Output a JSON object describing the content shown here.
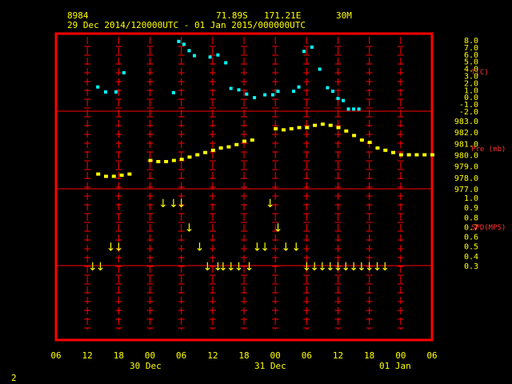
{
  "header": {
    "station_id": "8984",
    "latitude": "71.89S",
    "longitude": "171.21E",
    "interval": "30M",
    "time_range": "29 Dec 2014/120000UTC - 01 Jan 2015/000000UTC"
  },
  "footer": {
    "page_number": "2"
  },
  "colors": {
    "frame": "#ff0000",
    "text": "#ffff00",
    "temperature": "#00ffff",
    "pressure": "#ffff00",
    "wind": "#ffff00"
  },
  "chart_data": [
    {
      "type": "scatter",
      "panel": "temperature",
      "ylabel": "T(C)",
      "ylim": [
        -2.0,
        8.0
      ],
      "yticks": [
        "8.0",
        "7.0",
        "6.0",
        "5.0",
        "4.0",
        "3.0",
        "2.0",
        "1.0",
        "0.0",
        "-1.0",
        "-2.0"
      ],
      "x_hours": [
        14,
        15.5,
        17.5,
        19,
        28.5,
        29.5,
        30.5,
        31.5,
        32.5,
        35.5,
        37,
        38.5,
        39.5,
        41,
        42.5,
        44,
        46,
        47.5,
        48.5,
        51.5,
        52.5,
        53.5,
        55,
        56.5,
        58,
        59,
        60,
        61,
        62,
        63,
        64
      ],
      "values": [
        1.4,
        0.7,
        0.7,
        3.4,
        0.6,
        7.8,
        7.4,
        6.5,
        5.8,
        5.6,
        5.9,
        4.8,
        1.2,
        1.0,
        0.4,
        -0.1,
        0.3,
        0.3,
        0.8,
        0.8,
        1.4,
        6.4,
        7.0,
        3.9,
        1.3,
        0.8,
        -0.2,
        -0.5,
        -1.7,
        -1.7,
        -1.7,
        -0.8,
        -0.2,
        0.0
      ]
    },
    {
      "type": "scatter",
      "panel": "pressure",
      "ylabel": "Pre (mb)",
      "ylim": [
        977.0,
        983.0
      ],
      "yticks": [
        "983.0",
        "982.0",
        "981.0",
        "980.0",
        "979.0",
        "978.0",
        "977.0"
      ],
      "x_hours": [
        14,
        15.5,
        17,
        18.5,
        20,
        24,
        25.5,
        27,
        28.5,
        30,
        31.5,
        33,
        34.5,
        36,
        37.5,
        39,
        40.5,
        42,
        43.5,
        48,
        49.5,
        51,
        52.5,
        54,
        55.5,
        57,
        58.5,
        60,
        61.5,
        63,
        64.5,
        66,
        67.5,
        69,
        70.5,
        72,
        73.5,
        75,
        76.5,
        78
      ],
      "values": [
        978.3,
        978.1,
        978.1,
        978.2,
        978.3,
        979.5,
        979.4,
        979.4,
        979.5,
        979.6,
        979.8,
        980.0,
        980.2,
        980.4,
        980.6,
        980.7,
        980.9,
        981.2,
        981.3,
        982.3,
        982.2,
        982.3,
        982.4,
        982.4,
        982.6,
        982.7,
        982.6,
        982.4,
        982.1,
        981.7,
        981.3,
        981.1,
        980.6,
        980.4,
        980.2,
        980.0,
        980.0,
        980.0,
        980.0,
        980.0
      ]
    },
    {
      "type": "scatter",
      "panel": "wind_speed",
      "ylabel": "SPD(MPS)",
      "ylim": [
        0.3,
        1.0
      ],
      "yticks": [
        "1.0",
        "0.9",
        "0.8",
        "0.7",
        "0.6",
        "0.5",
        "0.4",
        "0.3"
      ],
      "x_hours": [
        13,
        14.5,
        16.5,
        18,
        26.5,
        28.5,
        30,
        31.5,
        33.5,
        35,
        37,
        38,
        39.5,
        41,
        43,
        44.5,
        46,
        47,
        48.5,
        50,
        52,
        54,
        55.5,
        57,
        58.5,
        60,
        61.5,
        63,
        64.5,
        66,
        67.5,
        69
      ],
      "values": [
        0.3,
        0.3,
        0.5,
        0.5,
        0.95,
        0.95,
        0.95,
        0.7,
        0.5,
        0.3,
        0.3,
        0.3,
        0.3,
        0.3,
        0.3,
        0.5,
        0.5,
        0.95,
        0.7,
        0.5,
        0.5,
        0.3,
        0.3,
        0.3,
        0.3,
        0.3,
        0.3,
        0.3,
        0.3,
        0.3,
        0.3,
        0.3
      ]
    }
  ],
  "x_axis": {
    "tick_labels": [
      "06",
      "12",
      "18",
      "00",
      "06",
      "12",
      "18",
      "00",
      "06",
      "12",
      "18",
      "00",
      "06"
    ],
    "day_labels": [
      "30 Dec",
      "31 Dec",
      "01 Jan"
    ]
  }
}
